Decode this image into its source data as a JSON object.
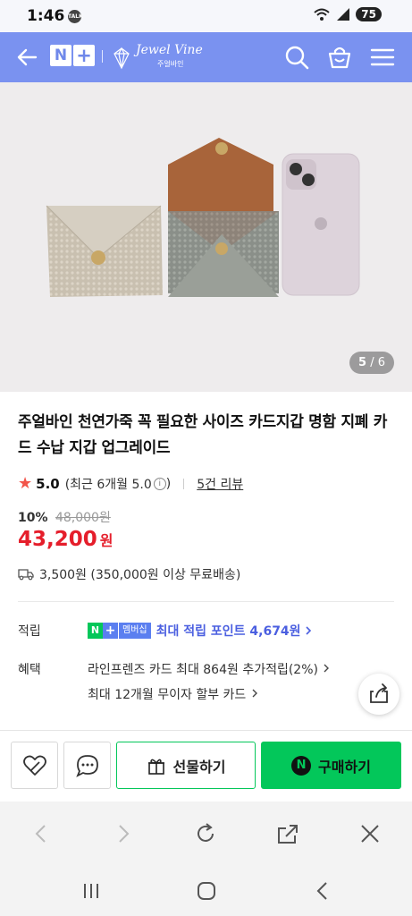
{
  "status_bar": {
    "time": "1:46",
    "notification_badge": "TALK",
    "battery": "75"
  },
  "header": {
    "logo_n": "N",
    "logo_plus": "+",
    "brand_name": "Jewel Vine",
    "brand_subtitle": "주얼바인",
    "accent_color": "#7a92f0",
    "icons": [
      "back-arrow-icon",
      "search-icon",
      "cart-icon",
      "menu-icon"
    ]
  },
  "product_image": {
    "current_page": "5",
    "total_pages": "6",
    "separator": "/"
  },
  "product": {
    "title": "주얼바인 천연가죽 꼭 필요한 사이즈 카드지갑 명함 지폐 카드 수납 지갑 업그레이드",
    "rating": "5.0",
    "rating_desc": "(최근 6개월 5.0",
    "rating_desc_close": ")",
    "review_count": "5건 리뷰",
    "discount_rate": "10%",
    "original_price": "48,000원",
    "price": "43,200",
    "currency": "원",
    "shipping": "3,500원 (350,000원 이상 무료배송)"
  },
  "points": {
    "label": "적립",
    "badge_n": "N",
    "badge_plus": "+",
    "badge_text": "멤버십",
    "text": "최대 적립 포인트 4,674원"
  },
  "benefits": {
    "label": "혜택",
    "items": [
      "라인프렌즈 카드 최대 864원 추가적립(2%)",
      "최대 12개월 무이자 할부 카드"
    ]
  },
  "actions": {
    "gift_label": "선물하기",
    "buy_label": "구매하기",
    "buy_icon_letter": "N",
    "buy_color": "#03c75a"
  }
}
